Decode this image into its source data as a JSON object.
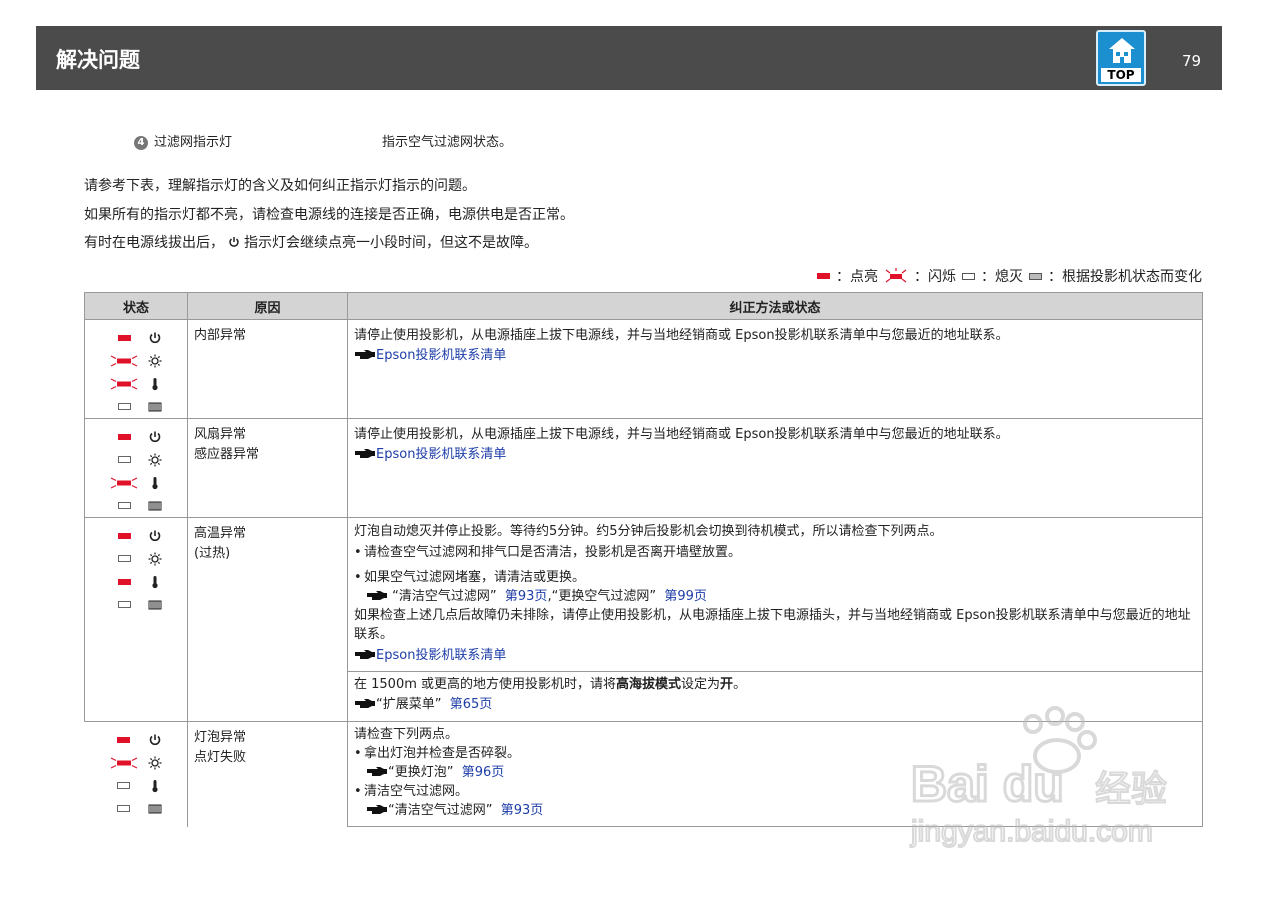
{
  "header": {
    "title": "解决问题",
    "page_number": "79",
    "top_label": "TOP"
  },
  "filter_indicator": {
    "number": "4",
    "label": "过滤网指示灯",
    "desc": "指示空气过滤网状态。"
  },
  "intro": {
    "line1": "请参考下表，理解指示灯的含义及如何纠正指示灯指示的问题。",
    "line2": "如果所有的指示灯都不亮，请检查电源线的连接是否正确，电源供电是否正常。",
    "line3_pre": "有时在电源线拔出后，",
    "line3_post": "指示灯会继续点亮一小段时间，但这不是故障。"
  },
  "legend": {
    "on": "：点亮",
    "blink": "：闪烁",
    "off": "：熄灭",
    "varies": "：根据投影机状态而变化"
  },
  "table": {
    "headers": [
      "状态",
      "原因",
      "纠正方法或状态"
    ],
    "rows": [
      {
        "indicators": [
          "on",
          "blink",
          "blink",
          "off"
        ],
        "cause": [
          "内部异常"
        ],
        "remedy": "请停止使用投影机，从电源插座上拔下电源线，并与当地经销商或 Epson投影机联系清单中与您最近的地址联系。",
        "ref": "Epson投影机联系清单"
      },
      {
        "indicators": [
          "on",
          "off",
          "blink",
          "off"
        ],
        "cause": [
          "风扇异常",
          "感应器异常"
        ],
        "remedy": "请停止使用投影机，从电源插座上拔下电源线，并与当地经销商或 Epson投影机联系清单中与您最近的地址联系。",
        "ref": "Epson投影机联系清单"
      },
      {
        "indicators": [
          "on",
          "off",
          "on",
          "off"
        ],
        "cause": [
          "高温异常",
          "(过热)"
        ],
        "remedy_a": {
          "intro": "灯泡自动熄灭并停止投影。等待约5分钟。约5分钟后投影机会切换到待机模式，所以请检查下列两点。",
          "bullet1": "请检查空气过滤网和排气口是否清洁，投影机是否离开墙壁放置。",
          "bullet2": "如果空气过滤网堵塞，请清洁或更换。",
          "bullet2_ref1": "“清洁空气过滤网”",
          "bullet2_ref1_page": "第93页",
          "bullet2_sep": ",",
          "bullet2_ref2": "“更换空气过滤网”",
          "bullet2_ref2_page": "第99页",
          "after": "如果检查上述几点后故障仍未排除，请停止使用投影机，从电源插座上拔下电源插头，并与当地经销商或 Epson投影机联系清单中与您最近的地址联系。",
          "ref": "Epson投影机联系清单"
        },
        "remedy_b": {
          "pre": "在 1500m 或更高的地方使用投影机时，请将",
          "bold": "高海拔模式",
          "mid": "设定为",
          "bold2": "开",
          "post": "。",
          "ref_label": "“扩展菜单”",
          "ref_page": "第65页"
        }
      },
      {
        "indicators": [
          "on",
          "blink",
          "off",
          "off"
        ],
        "cause": [
          "灯泡异常",
          "点灯失败"
        ],
        "remedy_c": {
          "intro": "请检查下列两点。",
          "bullet1": "拿出灯泡并检查是否碎裂。",
          "bullet1_ref": "“更换灯泡”",
          "bullet1_ref_page": "第96页",
          "bullet2": "清洁空气过滤网。",
          "bullet2_ref": "“清洁空气过滤网”",
          "bullet2_ref_page": "第93页"
        }
      }
    ]
  },
  "colors": {
    "indicator_red": "#e0122a",
    "link_blue": "#1d3da8",
    "header_bg": "#4b4b4b"
  },
  "icons": [
    "power-icon",
    "lamp-icon",
    "temperature-icon",
    "filter-icon",
    "pointing-hand-icon"
  ]
}
